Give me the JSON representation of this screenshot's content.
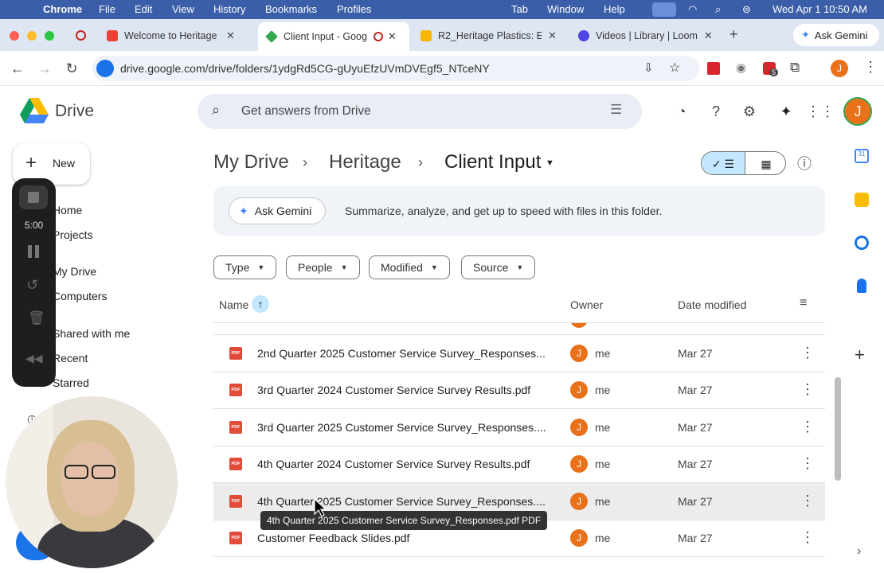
{
  "menubar": {
    "app": "Chrome",
    "items": [
      "File",
      "Edit",
      "View",
      "History",
      "Bookmarks",
      "Profiles"
    ],
    "right": [
      "Tab",
      "Window",
      "Help"
    ],
    "datetime": "Wed Apr 1  10:50 AM"
  },
  "tabs": [
    {
      "title": "Welcome to Heritage P",
      "color": "#ea4335"
    },
    {
      "title": "Client Input - Goog",
      "color": "#34a853",
      "active": true
    },
    {
      "title": "R2_Heritage Plastics: E",
      "color": "#f6b704"
    },
    {
      "title": "Videos | Library | Loom",
      "color": "#4f46e5"
    }
  ],
  "ask_gemini_chrome": "Ask Gemini",
  "url": "drive.google.com/drive/folders/1ydgRd5CG-gUyuEfzUVmDVEgf5_NTceNY",
  "extension_badge": "5",
  "profile_initial": "J",
  "drive": {
    "logo_text": "Drive",
    "search_placeholder": "Get answers from Drive",
    "new_label": "New",
    "breadcrumb": [
      "My Drive",
      "Heritage",
      "Client Input"
    ],
    "gemini_button": "Ask Gemini",
    "gemini_text": "Summarize, analyze, and get up to speed with files in this folder.",
    "filters": [
      "Type",
      "People",
      "Modified",
      "Source"
    ],
    "columns": {
      "name": "Name",
      "owner": "Owner",
      "date": "Date modified"
    },
    "nav": [
      "Home",
      "Projects",
      "My Drive",
      "Computers",
      "Shared with me",
      "Recent",
      "Starred"
    ],
    "files": [
      {
        "name": "2nd Quarter 2025 Customer Service Survey_Responses...",
        "owner": "me",
        "date": "Mar 27"
      },
      {
        "name": "3rd Quarter 2024 Customer Service Survey Results.pdf",
        "owner": "me",
        "date": "Mar 27"
      },
      {
        "name": "3rd Quarter 2025 Customer Service Survey_Responses....",
        "owner": "me",
        "date": "Mar 27"
      },
      {
        "name": "4th Quarter 2024 Customer Service Survey Results.pdf",
        "owner": "me",
        "date": "Mar 27"
      },
      {
        "name": "4th Quarter 2025 Customer Service Survey_Responses....",
        "owner": "me",
        "date": "Mar 27"
      },
      {
        "name": "Customer Feedback Slides.pdf",
        "owner": "me",
        "date": "Mar 27"
      }
    ],
    "tooltip": "4th Quarter 2025 Customer Service Survey_Responses.pdf PDF",
    "pdf_badge": "PDF"
  },
  "recorder": {
    "timer": "5:00"
  },
  "colors": {
    "menubar": "#3a5ea8",
    "tabstrip": "#dfe6f3",
    "selected_view": "#c2e7ff",
    "avatar": "#e8711a",
    "pdf": "#e24b3a"
  }
}
